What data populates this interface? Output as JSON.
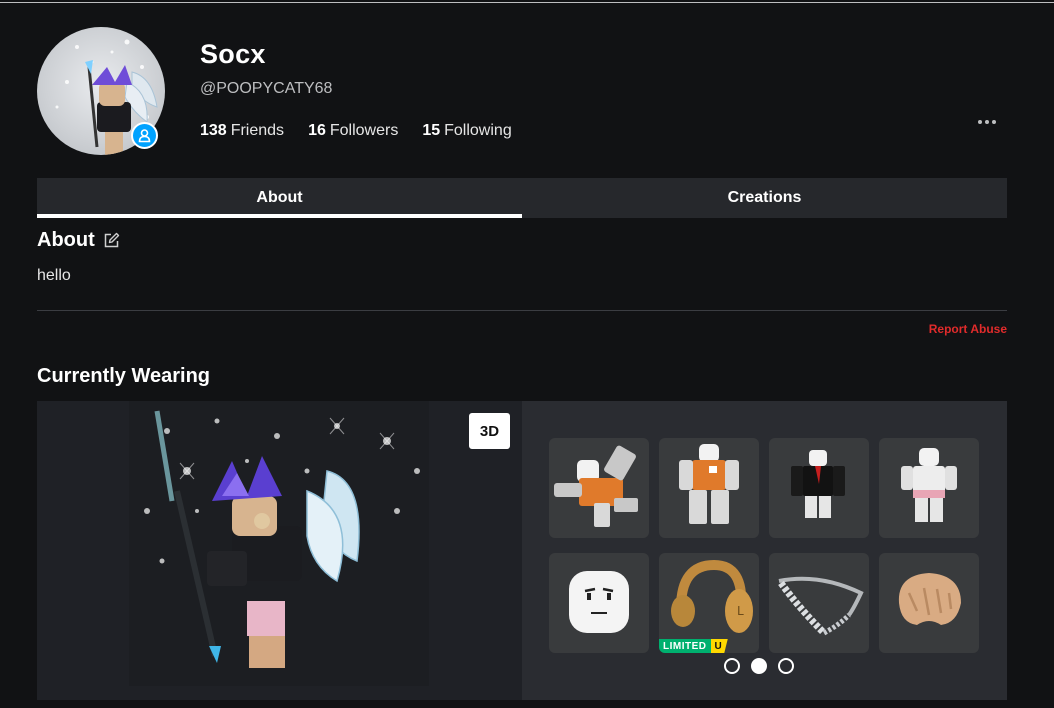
{
  "profile": {
    "display_name": "Socx",
    "username": "@POOPYCATY68",
    "friends_count": "138",
    "friends_label": "Friends",
    "followers_count": "16",
    "followers_label": "Followers",
    "following_count": "15",
    "following_label": "Following"
  },
  "tabs": [
    {
      "label": "About",
      "active": true
    },
    {
      "label": "Creations",
      "active": false
    }
  ],
  "about": {
    "title": "About",
    "text": "hello",
    "report_label": "Report Abuse"
  },
  "wearing": {
    "title": "Currently Wearing",
    "toggle_3d_label": "3D",
    "items": [
      {
        "icon": "animation-pack-icon"
      },
      {
        "icon": "orange-shirt-avatar-icon"
      },
      {
        "icon": "black-suit-icon"
      },
      {
        "icon": "white-outfit-icon"
      },
      {
        "icon": "face-icon"
      },
      {
        "icon": "headphones-icon",
        "badge_primary": "LIMITED",
        "badge_secondary": "U"
      },
      {
        "icon": "chain-necklace-icon"
      },
      {
        "icon": "hair-icon"
      }
    ],
    "pager": {
      "pages": 3,
      "current": 2
    }
  },
  "colors": {
    "background": "#111214",
    "tab_bar": "#26282c",
    "item_panel": "#2a2c31",
    "report_red": "#e02b2b",
    "presence_blue": "#00a2ff",
    "limited_green": "#00b06f",
    "limited_yellow": "#ffd800"
  }
}
